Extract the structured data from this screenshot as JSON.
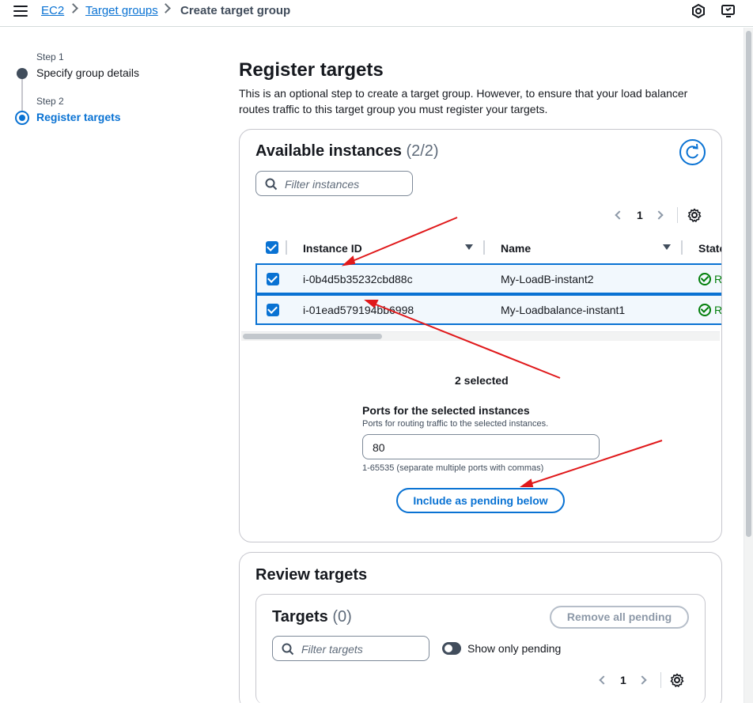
{
  "breadcrumb": {
    "items": [
      {
        "label": "EC2"
      },
      {
        "label": "Target groups"
      }
    ],
    "current": "Create target group"
  },
  "icons": {
    "menu": "menu-icon",
    "settings_top": "cloudshell-icon",
    "notifications": "support-icon",
    "refresh": "refresh-icon",
    "search": "search-icon",
    "gear": "gear-icon",
    "status_ok": "status-success-icon"
  },
  "steps": [
    {
      "step": "Step 1",
      "title": "Specify group details",
      "active": false
    },
    {
      "step": "Step 2",
      "title": "Register targets",
      "active": true
    }
  ],
  "main": {
    "title": "Register targets",
    "description": "This is an optional step to create a target group. However, to ensure that your load balancer routes traffic to this target group you must register your targets."
  },
  "available": {
    "title": "Available instances",
    "count": "(2/2)",
    "filter_placeholder": "Filter instances",
    "page": "1",
    "columns": [
      "Instance ID",
      "Name",
      "State"
    ],
    "rows": [
      {
        "instance_id": "i-0b4d5b35232cbd88c",
        "name": "My-LoadB-instant2",
        "state": "R",
        "checked": true
      },
      {
        "instance_id": "i-01ead579194bb6998",
        "name": "My-Loadbalance-instant1",
        "state": "R",
        "checked": true
      }
    ],
    "selected_text": "2 selected",
    "ports_label": "Ports for the selected instances",
    "ports_desc": "Ports for routing traffic to the selected instances.",
    "ports_value": "80",
    "ports_hint": "1-65535 (separate multiple ports with commas)",
    "include_button": "Include as pending below"
  },
  "review": {
    "title": "Review targets",
    "targets_title": "Targets",
    "targets_count": "(0)",
    "remove_button": "Remove all pending",
    "filter_placeholder": "Filter targets",
    "toggle_label": "Show only pending",
    "page": "1"
  },
  "colors": {
    "accent": "#0972d3",
    "success": "#037f0c",
    "annotation": "#e0191b"
  }
}
